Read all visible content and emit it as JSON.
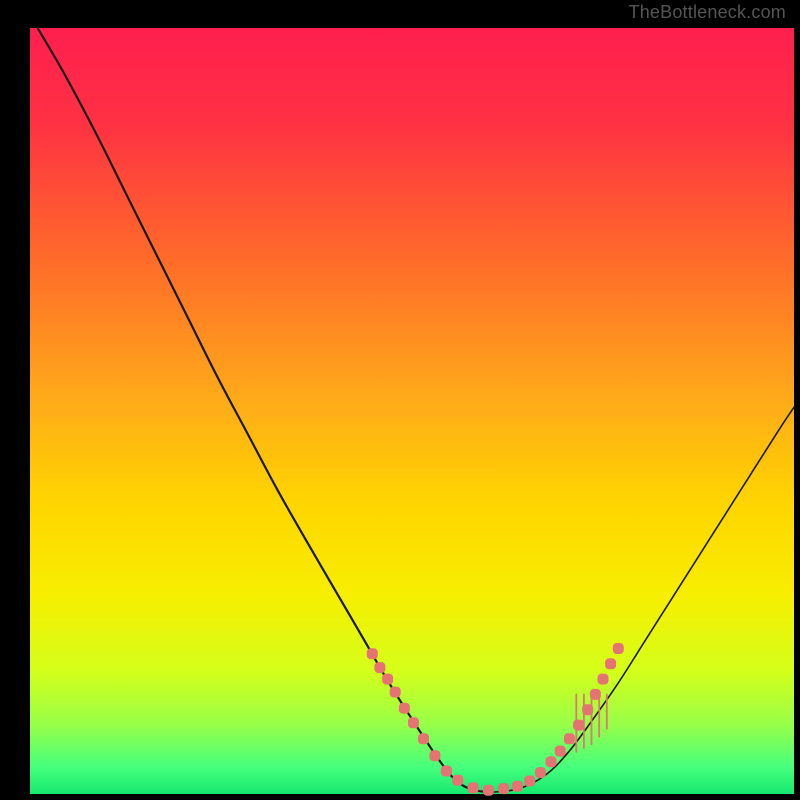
{
  "watermark": "TheBottleneck.com",
  "plot": {
    "inner_left": 30,
    "inner_top": 28,
    "inner_right": 794,
    "inner_bottom": 794,
    "gradient_stops": [
      {
        "offset": 0.0,
        "color": "#ff1f4e"
      },
      {
        "offset": 0.12,
        "color": "#ff3044"
      },
      {
        "offset": 0.3,
        "color": "#ff6a2a"
      },
      {
        "offset": 0.48,
        "color": "#ffa91a"
      },
      {
        "offset": 0.62,
        "color": "#ffd500"
      },
      {
        "offset": 0.74,
        "color": "#f7ee00"
      },
      {
        "offset": 0.84,
        "color": "#d4ff1a"
      },
      {
        "offset": 0.91,
        "color": "#97ff49"
      },
      {
        "offset": 0.965,
        "color": "#46ff7d"
      },
      {
        "offset": 1.0,
        "color": "#15e86f"
      }
    ],
    "left_curve": [
      {
        "x": 0.01,
        "y": 0.0
      },
      {
        "x": 0.045,
        "y": 0.06
      },
      {
        "x": 0.085,
        "y": 0.135
      },
      {
        "x": 0.125,
        "y": 0.215
      },
      {
        "x": 0.165,
        "y": 0.295
      },
      {
        "x": 0.205,
        "y": 0.375
      },
      {
        "x": 0.245,
        "y": 0.455
      },
      {
        "x": 0.285,
        "y": 0.53
      },
      {
        "x": 0.325,
        "y": 0.605
      },
      {
        "x": 0.365,
        "y": 0.675
      },
      {
        "x": 0.4,
        "y": 0.735
      },
      {
        "x": 0.435,
        "y": 0.795
      },
      {
        "x": 0.47,
        "y": 0.855
      },
      {
        "x": 0.505,
        "y": 0.91
      },
      {
        "x": 0.535,
        "y": 0.955
      },
      {
        "x": 0.555,
        "y": 0.98
      },
      {
        "x": 0.575,
        "y": 0.993
      },
      {
        "x": 0.6,
        "y": 0.998
      }
    ],
    "right_curve": [
      {
        "x": 0.6,
        "y": 0.998
      },
      {
        "x": 0.64,
        "y": 0.993
      },
      {
        "x": 0.675,
        "y": 0.975
      },
      {
        "x": 0.705,
        "y": 0.945
      },
      {
        "x": 0.735,
        "y": 0.905
      },
      {
        "x": 0.77,
        "y": 0.855
      },
      {
        "x": 0.805,
        "y": 0.8
      },
      {
        "x": 0.84,
        "y": 0.745
      },
      {
        "x": 0.875,
        "y": 0.69
      },
      {
        "x": 0.91,
        "y": 0.635
      },
      {
        "x": 0.945,
        "y": 0.58
      },
      {
        "x": 0.98,
        "y": 0.525
      },
      {
        "x": 1.0,
        "y": 0.495
      }
    ],
    "markers": [
      {
        "x": 0.448,
        "y": 0.817
      },
      {
        "x": 0.458,
        "y": 0.835
      },
      {
        "x": 0.468,
        "y": 0.85
      },
      {
        "x": 0.478,
        "y": 0.867
      },
      {
        "x": 0.49,
        "y": 0.888
      },
      {
        "x": 0.502,
        "y": 0.907
      },
      {
        "x": 0.515,
        "y": 0.928
      },
      {
        "x": 0.53,
        "y": 0.95
      },
      {
        "x": 0.545,
        "y": 0.97
      },
      {
        "x": 0.56,
        "y": 0.982
      },
      {
        "x": 0.58,
        "y": 0.992
      },
      {
        "x": 0.6,
        "y": 0.995
      },
      {
        "x": 0.62,
        "y": 0.993
      },
      {
        "x": 0.638,
        "y": 0.99
      },
      {
        "x": 0.654,
        "y": 0.983
      },
      {
        "x": 0.668,
        "y": 0.972
      },
      {
        "x": 0.682,
        "y": 0.958
      },
      {
        "x": 0.694,
        "y": 0.944
      },
      {
        "x": 0.706,
        "y": 0.928
      },
      {
        "x": 0.718,
        "y": 0.91
      },
      {
        "x": 0.73,
        "y": 0.89
      },
      {
        "x": 0.74,
        "y": 0.87
      },
      {
        "x": 0.75,
        "y": 0.85
      },
      {
        "x": 0.76,
        "y": 0.83
      },
      {
        "x": 0.77,
        "y": 0.81
      }
    ],
    "hash_ticks": [
      {
        "x": 0.715,
        "y0": 0.87,
        "y1": 0.945
      },
      {
        "x": 0.725,
        "y0": 0.87,
        "y1": 0.94
      },
      {
        "x": 0.735,
        "y0": 0.87,
        "y1": 0.935
      },
      {
        "x": 0.745,
        "y0": 0.87,
        "y1": 0.925
      },
      {
        "x": 0.755,
        "y0": 0.87,
        "y1": 0.915
      }
    ]
  },
  "colors": {
    "curve": "#1a1a1a",
    "marker": "#e57373",
    "hash": "#e57373"
  },
  "chart_data": {
    "type": "line",
    "title": "",
    "xlabel": "",
    "ylabel": "",
    "xlim": [
      0,
      1
    ],
    "ylim": [
      0,
      1
    ],
    "legend": [],
    "annotations": [
      "TheBottleneck.com"
    ],
    "series": [
      {
        "name": "bottleneck-curve",
        "x": [
          0.01,
          0.045,
          0.085,
          0.125,
          0.165,
          0.205,
          0.245,
          0.285,
          0.325,
          0.365,
          0.4,
          0.435,
          0.47,
          0.505,
          0.535,
          0.555,
          0.575,
          0.6,
          0.64,
          0.675,
          0.705,
          0.735,
          0.77,
          0.805,
          0.84,
          0.875,
          0.91,
          0.945,
          0.98,
          1.0
        ],
        "y": [
          1.0,
          0.94,
          0.865,
          0.785,
          0.705,
          0.625,
          0.545,
          0.47,
          0.395,
          0.325,
          0.265,
          0.205,
          0.145,
          0.09,
          0.045,
          0.02,
          0.007,
          0.002,
          0.007,
          0.025,
          0.055,
          0.095,
          0.145,
          0.2,
          0.255,
          0.31,
          0.365,
          0.42,
          0.475,
          0.505
        ]
      },
      {
        "name": "highlighted-region",
        "x": [
          0.448,
          0.458,
          0.468,
          0.478,
          0.49,
          0.502,
          0.515,
          0.53,
          0.545,
          0.56,
          0.58,
          0.6,
          0.62,
          0.638,
          0.654,
          0.668,
          0.682,
          0.694,
          0.706,
          0.718,
          0.73,
          0.74,
          0.75,
          0.76,
          0.77
        ],
        "y": [
          0.183,
          0.165,
          0.15,
          0.133,
          0.112,
          0.093,
          0.072,
          0.05,
          0.03,
          0.018,
          0.008,
          0.005,
          0.007,
          0.01,
          0.017,
          0.028,
          0.042,
          0.056,
          0.072,
          0.09,
          0.11,
          0.13,
          0.15,
          0.17,
          0.19
        ]
      }
    ]
  }
}
